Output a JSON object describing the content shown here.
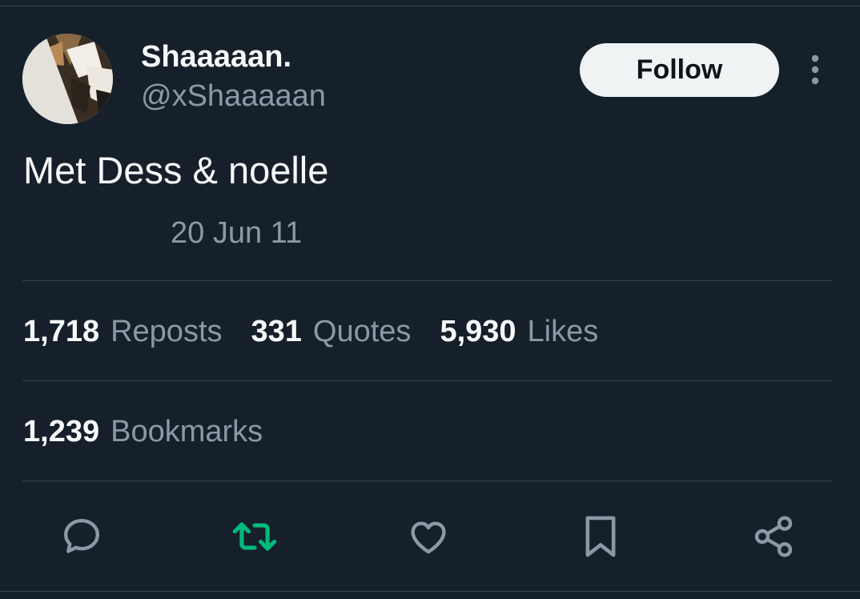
{
  "author": {
    "display_name": "Shaaaaan.",
    "handle": "@xShaaaaan"
  },
  "follow_label": "Follow",
  "tweet": {
    "text": "Met Dess & noelle",
    "timestamp": "20 Jun 11"
  },
  "stats": {
    "reposts": {
      "count": "1,718",
      "label": "Reposts"
    },
    "quotes": {
      "count": "331",
      "label": "Quotes"
    },
    "likes": {
      "count": "5,930",
      "label": "Likes"
    },
    "bookmarks": {
      "count": "1,239",
      "label": "Bookmarks"
    }
  },
  "actions": [
    "reply-icon",
    "repost-icon",
    "like-icon",
    "bookmark-icon",
    "share-icon"
  ],
  "colors": {
    "background": "#15202b",
    "primary_text": "#f7f9f9",
    "secondary_text": "#8b98a5",
    "divider": "#38444d",
    "repost_active": "#00ba7c",
    "follow_bg": "#eff3f4"
  }
}
